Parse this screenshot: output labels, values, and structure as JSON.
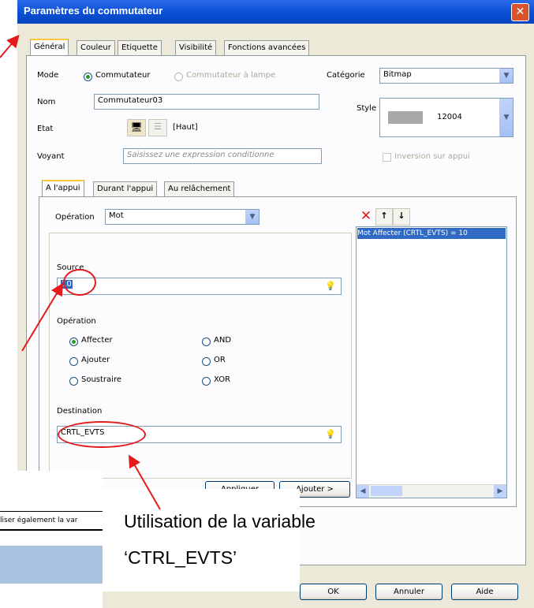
{
  "window": {
    "title": "Paramètres du commutateur",
    "close_label": "✕"
  },
  "tabs": [
    "Général",
    "Couleur",
    "Etiquette",
    "Visibilité",
    "Fonctions avancées"
  ],
  "general": {
    "mode_label": "Mode",
    "mode_option1": "Commutateur",
    "mode_option2": "Commutateur à lampe",
    "categorie_label": "Catégorie",
    "categorie_value": "Bitmap",
    "nom_label": "Nom",
    "nom_value": "Commutateur03",
    "style_label": "Style",
    "style_value": "12004",
    "etat_label": "Etat",
    "etat_value": "[Haut]",
    "voyant_label": "Voyant",
    "voyant_placeholder": "Saisissez une expression conditionne",
    "inversion_label": "Inversion sur appui"
  },
  "subtabs": [
    "A l'appui",
    "Durant l'appui",
    "Au relâchement"
  ],
  "appui": {
    "operation_label": "Opération",
    "operation_value": "Mot",
    "source_label": "Source",
    "source_value": "10",
    "op_group_label": "Opération",
    "ops": [
      "Affecter",
      "Ajouter",
      "Soustraire",
      "AND",
      "OR",
      "XOR"
    ],
    "destination_label": "Destination",
    "destination_value": "CRTL_EVTS",
    "list_item": "Mot Affecter (CRTL_EVTS) = 10",
    "apply_button": "Appliquer",
    "add_button": "Ajouter >"
  },
  "footer": {
    "ok": "OK",
    "cancel": "Annuler",
    "help": "Aide"
  },
  "behind_text": "liser également la var",
  "annotation": {
    "line1": "Utilisation de la variable",
    "line2": "‘CTRL_EVTS’"
  },
  "colors": {
    "title_bar": "#0a4fd4",
    "tab_highlight": "#ffc83c",
    "annotation_red": "#e31b1b",
    "selection": "#316ac5"
  }
}
